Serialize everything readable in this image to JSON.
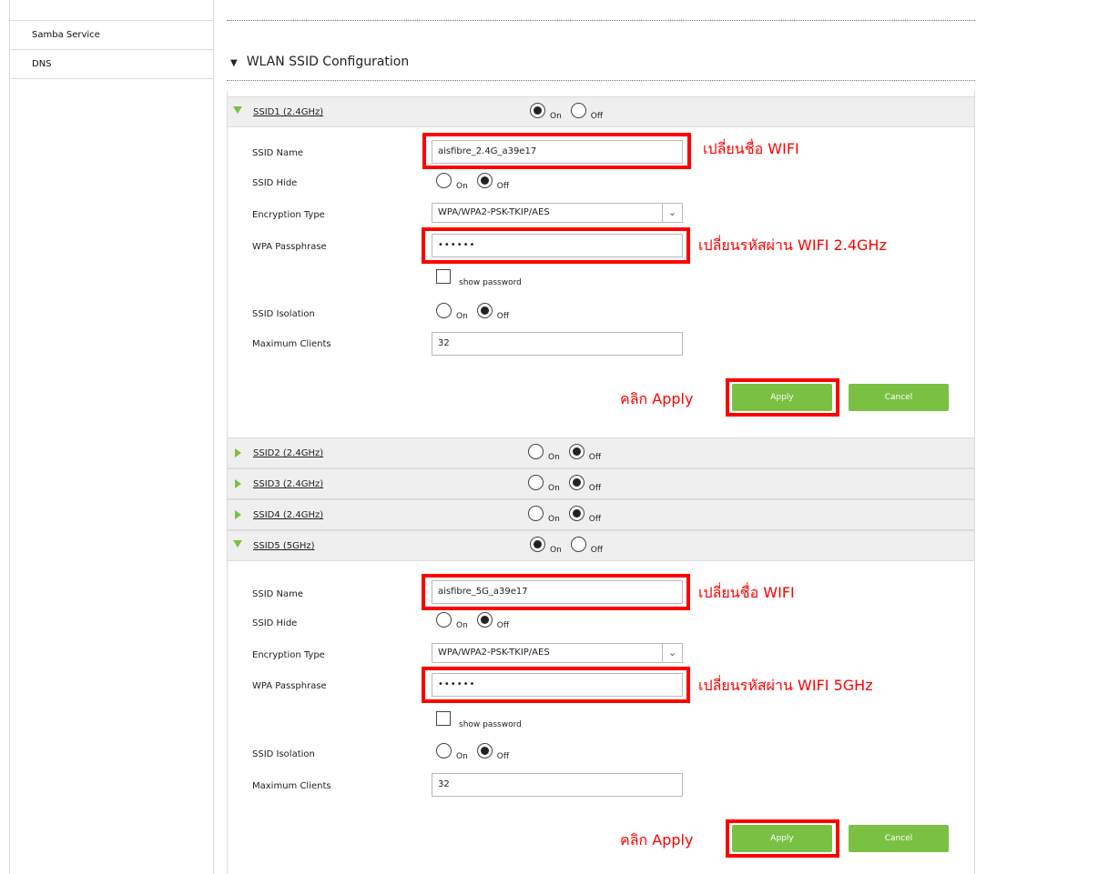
{
  "sidebar": {
    "items": [
      {
        "label": "Samba Service"
      },
      {
        "label": "DNS"
      }
    ]
  },
  "section": {
    "title": "WLAN SSID Configuration"
  },
  "radio": {
    "on": "On",
    "off": "Off"
  },
  "ssid1": {
    "title": "SSID1 (2.4GHz)",
    "enabled": true,
    "labels": {
      "name": "SSID Name",
      "hide": "SSID Hide",
      "encryption": "Encryption Type",
      "passphrase": "WPA Passphrase",
      "isolation": "SSID Isolation",
      "max_clients": "Maximum Clients"
    },
    "name_value": "aisfibre_2.4G_a39e17",
    "hide": "Off",
    "encryption": "WPA/WPA2-PSK-TKIP/AES",
    "passphrase_mask": "••••••",
    "show_password": "show password",
    "isolation": "Off",
    "max_clients": "32",
    "apply": "Apply",
    "cancel": "Cancel"
  },
  "ssid2": {
    "title": "SSID2 (2.4GHz)",
    "enabled": false
  },
  "ssid3": {
    "title": "SSID3 (2.4GHz)",
    "enabled": false
  },
  "ssid4": {
    "title": "SSID4 (2.4GHz)",
    "enabled": false
  },
  "ssid5": {
    "title": "SSID5 (5GHz)",
    "enabled": true,
    "labels": {
      "name": "SSID Name",
      "hide": "SSID Hide",
      "encryption": "Encryption Type",
      "passphrase": "WPA Passphrase",
      "isolation": "SSID Isolation",
      "max_clients": "Maximum Clients"
    },
    "name_value": "aisfibre_5G_a39e17",
    "hide": "Off",
    "encryption": "WPA/WPA2-PSK-TKIP/AES",
    "passphrase_mask": "••••••",
    "show_password": "show password",
    "isolation": "Off",
    "max_clients": "32",
    "apply": "Apply",
    "cancel": "Cancel"
  },
  "annotations": {
    "change_name": "เปลี่ยนชื่อ WIFI",
    "change_pass_24": "เปลี่ยนรหัสผ่าน WIFI 2.4GHz",
    "change_pass_5": "เปลี่ยนรหัสผ่าน WIFI 5GHz",
    "click_apply": "คลิก Apply"
  },
  "colors": {
    "accent": "#7ac143",
    "highlight": "#ff0000",
    "header_bg": "#efefef"
  }
}
